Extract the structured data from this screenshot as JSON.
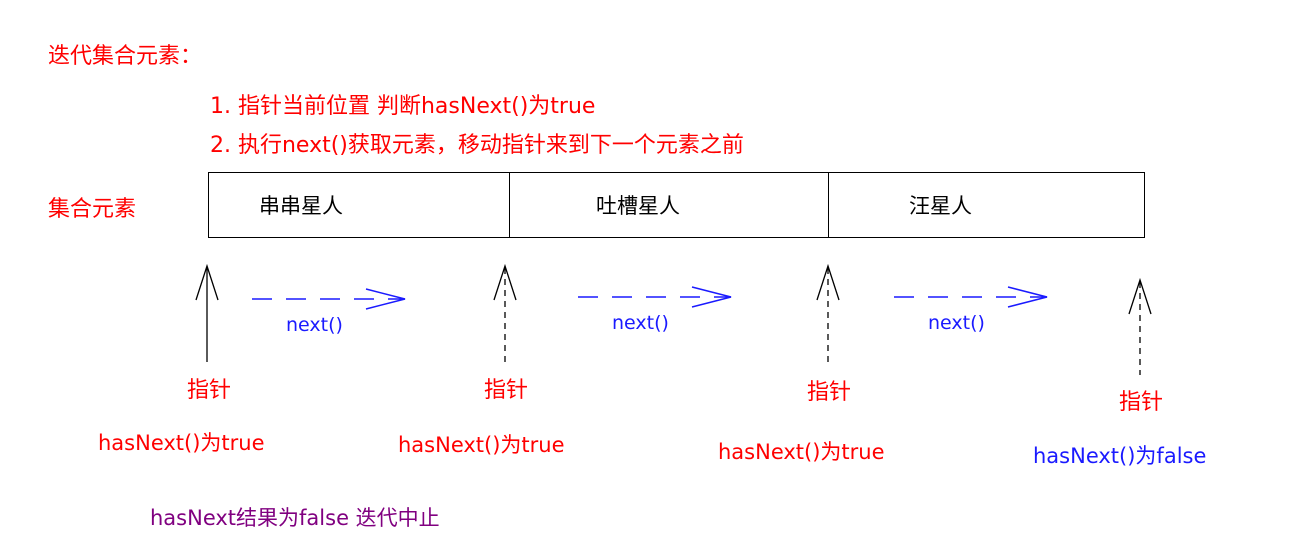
{
  "title": "迭代集合元素：",
  "steps": [
    "1. 指针当前位置 判断hasNext()为true",
    "2. 执行next()获取元素，移动指针来到下一个元素之前"
  ],
  "row_label": "集合元素",
  "elements": [
    "串串星人",
    "吐槽星人",
    "汪星人"
  ],
  "pointer_label": "指针",
  "has_next": [
    "hasNext()为true",
    "hasNext()为true",
    "hasNext()为true",
    "hasNext()为false"
  ],
  "next_label": "next()",
  "summary": "hasNext结果为false 迭代中止",
  "colors": {
    "red": "#ff0000",
    "blue": "#1a1aff",
    "purple": "#800080"
  }
}
